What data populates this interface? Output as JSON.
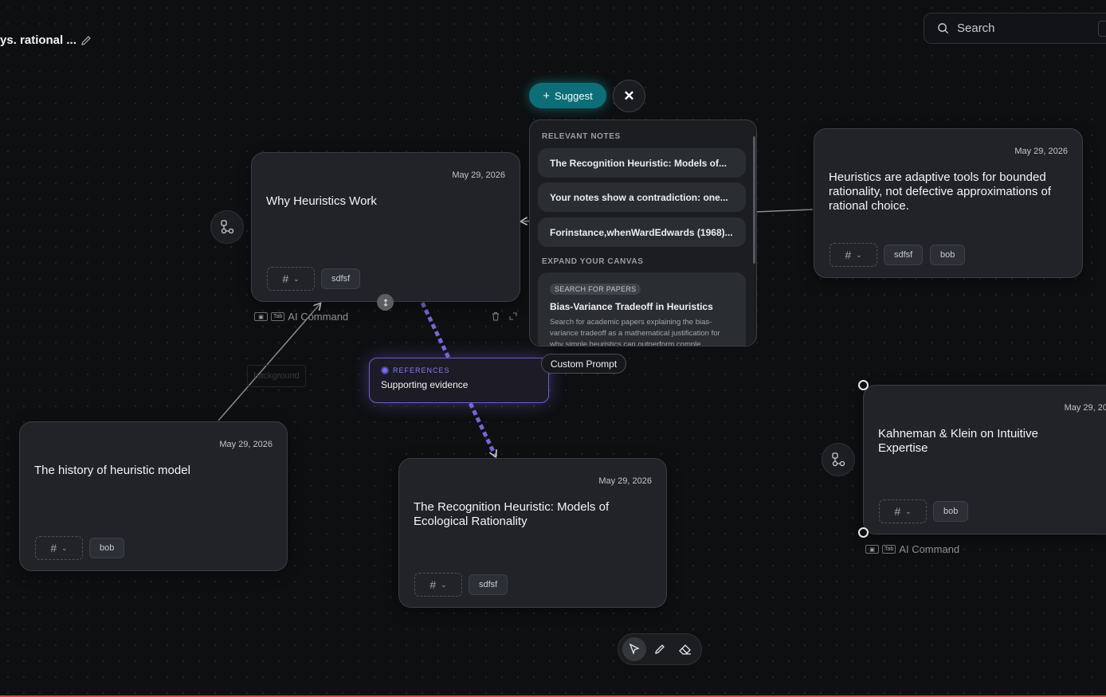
{
  "header": {
    "doc_title": "ys. rational ...",
    "search_placeholder": "Search"
  },
  "notes": [
    {
      "title": "Why Heuristics Work",
      "date": "May 29, 2026",
      "tags": [
        "sdfsf"
      ]
    },
    {
      "title": "Heuristics are adaptive tools for bounded rationality, not defective approximations of rational choice.",
      "date": "May 29, 2026",
      "tags": [
        "sdfsf",
        "bob"
      ]
    },
    {
      "title": "The history of heuristic model",
      "date": "May 29, 2026",
      "tags": [
        "bob"
      ]
    },
    {
      "title": "The Recognition Heuristic: Models of Ecological Rationality",
      "date": "May 29, 2026",
      "tags": [
        "sdfsf"
      ]
    },
    {
      "title": "Kahneman & Klein on Intuitive Expertise",
      "date": "May 29, 20",
      "tags": [
        "bob"
      ]
    }
  ],
  "tag_select_symbol": "#",
  "ai_command": {
    "label": "AI Command",
    "tab_key": "Tab"
  },
  "suggest": {
    "button_label": "Suggest",
    "close_label": "✕",
    "relevant_heading": "RELEVANT NOTES",
    "relevant_notes": [
      "The Recognition Heuristic: Models of...",
      "Your notes show a contradiction: one...",
      "Forinstance,whenWardEdwards (1968)..."
    ],
    "expand_heading": "EXPAND YOUR CANVAS",
    "paper": {
      "badge": "SEARCH FOR PAPERS",
      "title": "Bias-Variance Tradeoff in Heuristics",
      "description": "Search for academic papers explaining the bias-variance tradeoff as a mathematical justification for why simple heuristics can outperform comple..."
    },
    "custom_prompt": "Custom Prompt"
  },
  "edge_label": {
    "kind": "REFERENCES",
    "text": "Supporting evidence"
  },
  "background_label": "background",
  "toolbar": {
    "tools": [
      "select-tool",
      "pen-tool",
      "eraser-tool"
    ],
    "active": "select-tool"
  },
  "colors": {
    "accent_teal": "#0e6e78",
    "reference_purple": "#7c6df0",
    "canvas_bg": "#0e0f11"
  }
}
